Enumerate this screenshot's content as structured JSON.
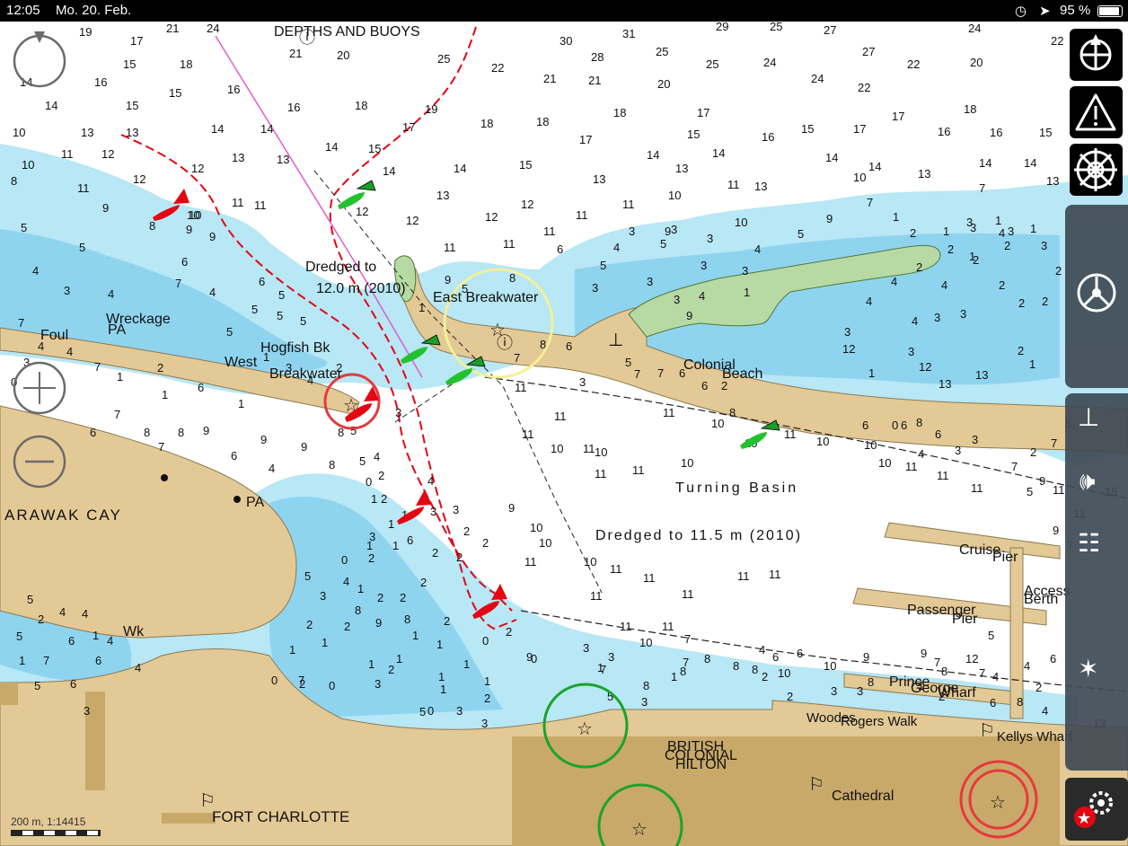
{
  "status": {
    "time": "12:05",
    "date": "Mo. 20. Feb.",
    "battery": "95 %"
  },
  "labels": {
    "depths_buoys": "DEPTHS AND BUOYS",
    "dredged_12": "Dredged to",
    "dredged_12b": "12.0 m (2010)",
    "east_breakwater": "East Breakwater",
    "wreckage": "Wreckage",
    "pa1": "PA",
    "foul": "Foul",
    "hogfish": "Hogfish Bk",
    "west": "West",
    "breakwater": "Breakwater",
    "colonial": "Colonial",
    "beach": "Beach",
    "turning_basin": "Turning Basin",
    "dredged_115": "Dredged to 11.5 m (2010)",
    "arawak": "ARAWAK CAY",
    "pa2": "PA",
    "wk": "Wk",
    "cruise": "Cruise",
    "pier1": "Pier",
    "access": "Access",
    "berth": "Berth",
    "passenger": "Passenger",
    "pier2": "Pier",
    "prince": "Prince",
    "george": "George",
    "wharf": "Wharf",
    "woodes": "Woodes",
    "rogers": "Rogers Walk",
    "kellys": "Kellys Wharf",
    "british": "BRITISH",
    "colonial2": "COLONIAL",
    "hilton": "HILTON",
    "cathedral": "Cathedral",
    "fort": "FORT CHARLOTTE"
  },
  "scale": {
    "text": "200 m, 1:14415"
  },
  "soundings": [
    [
      "19",
      88,
      40
    ],
    [
      "21",
      185,
      36
    ],
    [
      "24",
      230,
      36
    ],
    [
      "21",
      322,
      64
    ],
    [
      "20",
      375,
      66
    ],
    [
      "25",
      487,
      70
    ],
    [
      "22",
      547,
      80
    ],
    [
      "30",
      623,
      50
    ],
    [
      "31",
      693,
      42
    ],
    [
      "28",
      658,
      68
    ],
    [
      "25",
      730,
      62
    ],
    [
      "21",
      605,
      92
    ],
    [
      "21",
      655,
      94
    ],
    [
      "25",
      786,
      76
    ],
    [
      "29",
      797,
      34
    ],
    [
      "25",
      857,
      34
    ],
    [
      "27",
      917,
      38
    ],
    [
      "24",
      850,
      74
    ],
    [
      "27",
      960,
      62
    ],
    [
      "22",
      1010,
      76
    ],
    [
      "24",
      903,
      92
    ],
    [
      "22",
      955,
      102
    ],
    [
      "24",
      1078,
      36
    ],
    [
      "22",
      1170,
      50
    ],
    [
      "20",
      1080,
      74
    ],
    [
      "17",
      145,
      50
    ],
    [
      "15",
      137,
      76
    ],
    [
      "18",
      200,
      76
    ],
    [
      "16",
      105,
      96
    ],
    [
      "15",
      188,
      108
    ],
    [
      "15",
      140,
      122
    ],
    [
      "16",
      253,
      104
    ],
    [
      "16",
      320,
      124
    ],
    [
      "18",
      395,
      122
    ],
    [
      "19",
      473,
      126
    ],
    [
      "18",
      535,
      142
    ],
    [
      "18",
      597,
      140
    ],
    [
      "18",
      683,
      130
    ],
    [
      "20",
      732,
      98
    ],
    [
      "17",
      776,
      130
    ],
    [
      "15",
      765,
      154
    ],
    [
      "16",
      848,
      157
    ],
    [
      "15",
      892,
      148
    ],
    [
      "17",
      950,
      148
    ],
    [
      "17",
      993,
      134
    ],
    [
      "16",
      1044,
      151
    ],
    [
      "18",
      1073,
      126
    ],
    [
      "16",
      1102,
      152
    ],
    [
      "15",
      1157,
      152
    ],
    [
      "14",
      22,
      96
    ],
    [
      "14",
      50,
      122
    ],
    [
      "13",
      90,
      152
    ],
    [
      "13",
      140,
      152
    ],
    [
      "14",
      235,
      148
    ],
    [
      "14",
      290,
      148
    ],
    [
      "13",
      258,
      180
    ],
    [
      "13",
      308,
      182
    ],
    [
      "14",
      362,
      168
    ],
    [
      "15",
      410,
      170
    ],
    [
      "17",
      448,
      146
    ],
    [
      "17",
      645,
      160
    ],
    [
      "14",
      720,
      177
    ],
    [
      "14",
      793,
      175
    ],
    [
      "15",
      578,
      188
    ],
    [
      "14",
      505,
      192
    ],
    [
      "13",
      660,
      204
    ],
    [
      "13",
      752,
      192
    ],
    [
      "13",
      840,
      212
    ],
    [
      "14",
      919,
      180
    ],
    [
      "14",
      967,
      190
    ],
    [
      "13",
      1022,
      198
    ],
    [
      "14",
      1090,
      186
    ],
    [
      "14",
      1140,
      186
    ],
    [
      "13",
      1165,
      206
    ],
    [
      "7",
      1090,
      214
    ],
    [
      "10",
      14,
      152
    ],
    [
      "10",
      24,
      188
    ],
    [
      "8",
      12,
      206
    ],
    [
      "11",
      68,
      176
    ],
    [
      "12",
      113,
      176
    ],
    [
      "12",
      148,
      204
    ],
    [
      "12",
      213,
      192
    ],
    [
      "11",
      86,
      214
    ],
    [
      "9",
      114,
      236
    ],
    [
      "10",
      208,
      244
    ],
    [
      "9",
      207,
      260
    ],
    [
      "9",
      233,
      268
    ],
    [
      "14",
      426,
      195
    ],
    [
      "12",
      396,
      240
    ],
    [
      "13",
      486,
      222
    ],
    [
      "12",
      452,
      250
    ],
    [
      "12",
      540,
      246
    ],
    [
      "12",
      580,
      232
    ],
    [
      "11",
      605,
      262
    ],
    [
      "11",
      641,
      244
    ],
    [
      "11",
      693,
      232
    ],
    [
      "10",
      744,
      222
    ],
    [
      "11",
      810,
      210
    ],
    [
      "10",
      950,
      202
    ],
    [
      "9",
      740,
      262
    ],
    [
      "10",
      818,
      252
    ],
    [
      "5",
      23,
      258
    ],
    [
      "5",
      88,
      280
    ],
    [
      "4",
      36,
      306
    ],
    [
      "4",
      120,
      332
    ],
    [
      "3",
      71,
      328
    ],
    [
      "6",
      202,
      296
    ],
    [
      "7",
      195,
      320
    ],
    [
      "4",
      233,
      330
    ],
    [
      "5",
      280,
      349
    ],
    [
      "5",
      252,
      374
    ],
    [
      "6",
      288,
      318
    ],
    [
      "5",
      310,
      333
    ],
    [
      "5",
      308,
      356
    ],
    [
      "5",
      334,
      362
    ],
    [
      "11",
      258,
      230
    ],
    [
      "11",
      283,
      233
    ],
    [
      "8",
      166,
      256
    ],
    [
      "10",
      210,
      244
    ],
    [
      "9",
      495,
      316
    ],
    [
      "11",
      494,
      280
    ],
    [
      "11",
      560,
      276
    ],
    [
      "6",
      620,
      282
    ],
    [
      "4",
      683,
      280
    ],
    [
      "5",
      668,
      300
    ],
    [
      "5",
      735,
      276
    ],
    [
      "3",
      700,
      262
    ],
    [
      "3",
      747,
      260
    ],
    [
      "3",
      787,
      270
    ],
    [
      "9",
      920,
      248
    ],
    [
      "7",
      965,
      230
    ],
    [
      "5",
      888,
      265
    ],
    [
      "4",
      840,
      282
    ],
    [
      "3",
      780,
      300
    ],
    [
      "3",
      826,
      306
    ],
    [
      "2",
      1055,
      282
    ],
    [
      "3",
      1080,
      258
    ],
    [
      "2",
      1020,
      302
    ],
    [
      "1",
      1079,
      290
    ],
    [
      "2",
      1118,
      278
    ],
    [
      "2",
      1134,
      342
    ],
    [
      "2",
      1112,
      322
    ],
    [
      "4",
      992,
      318
    ],
    [
      "4",
      1048,
      322
    ],
    [
      "2",
      1175,
      306
    ],
    [
      "1",
      994,
      246
    ],
    [
      "2",
      1013,
      264
    ],
    [
      "1",
      1050,
      262
    ],
    [
      "1",
      1108,
      250
    ],
    [
      "2",
      1083,
      294
    ],
    [
      "3",
      1076,
      252
    ],
    [
      "4",
      1112,
      264
    ],
    [
      "3",
      1122,
      262
    ],
    [
      "1",
      1147,
      259
    ],
    [
      "3",
      1159,
      278
    ],
    [
      "2",
      1160,
      340
    ],
    [
      "7",
      20,
      364
    ],
    [
      "4",
      42,
      390
    ],
    [
      "4",
      74,
      396
    ],
    [
      "3",
      26,
      408
    ],
    [
      "0",
      12,
      430
    ],
    [
      "7",
      105,
      413
    ],
    [
      "1",
      130,
      424
    ],
    [
      "2",
      175,
      414
    ],
    [
      "1",
      180,
      444
    ],
    [
      "6",
      220,
      436
    ],
    [
      "1",
      265,
      454
    ],
    [
      "1",
      293,
      402
    ],
    [
      "3",
      318,
      414
    ],
    [
      "4",
      342,
      428
    ],
    [
      "2",
      374,
      414
    ],
    [
      "5",
      390,
      484
    ],
    [
      "3",
      440,
      464
    ],
    [
      "4",
      416,
      513
    ],
    [
      "1",
      466,
      347
    ],
    [
      "5",
      514,
      326
    ],
    [
      "8",
      567,
      314
    ],
    [
      "3",
      659,
      325
    ],
    [
      "3",
      720,
      318
    ],
    [
      "3",
      750,
      338
    ],
    [
      "4",
      778,
      334
    ],
    [
      "1",
      828,
      330
    ],
    [
      "9",
      764,
      356
    ],
    [
      "4",
      964,
      340
    ],
    [
      "4",
      1015,
      362
    ],
    [
      "3",
      1040,
      358
    ],
    [
      "3",
      1069,
      354
    ],
    [
      "3",
      940,
      374
    ],
    [
      "3",
      1011,
      396
    ],
    [
      "2",
      1133,
      395
    ],
    [
      "1",
      1146,
      410
    ],
    [
      "12",
      938,
      393
    ],
    [
      "12",
      1023,
      413
    ],
    [
      "13",
      1086,
      422
    ],
    [
      "13",
      1045,
      432
    ],
    [
      "1",
      967,
      420
    ],
    [
      "6",
      630,
      390
    ],
    [
      "8",
      601,
      388
    ],
    [
      "7",
      572,
      403
    ],
    [
      "3",
      645,
      430
    ],
    [
      "5",
      696,
      408
    ],
    [
      "7",
      706,
      421
    ],
    [
      "7",
      732,
      420
    ],
    [
      "6",
      756,
      420
    ],
    [
      "6",
      781,
      434
    ],
    [
      "2",
      803,
      434
    ],
    [
      "8",
      812,
      464
    ],
    [
      "11",
      573,
      436
    ],
    [
      "11",
      617,
      468
    ],
    [
      "11",
      738,
      464
    ],
    [
      "10",
      613,
      504
    ],
    [
      "11",
      581,
      488
    ],
    [
      "11",
      649,
      504
    ],
    [
      "10",
      662,
      508
    ],
    [
      "11",
      662,
      532
    ],
    [
      "11",
      704,
      528
    ],
    [
      "10",
      758,
      520
    ],
    [
      "10",
      792,
      476
    ],
    [
      "10",
      829,
      498
    ],
    [
      "11",
      873,
      488
    ],
    [
      "10",
      909,
      496
    ],
    [
      "10",
      962,
      500
    ],
    [
      "10",
      978,
      520
    ],
    [
      "11",
      1008,
      524
    ],
    [
      "11",
      1043,
      534
    ],
    [
      "11",
      1081,
      548
    ],
    [
      "11",
      1172,
      550
    ],
    [
      "7",
      1126,
      524
    ],
    [
      "9",
      1157,
      540
    ],
    [
      "5",
      1143,
      552
    ],
    [
      "4",
      1022,
      510
    ],
    [
      "3",
      1063,
      506
    ],
    [
      "6",
      1041,
      488
    ],
    [
      "8",
      1020,
      475
    ],
    [
      "6",
      1003,
      478
    ],
    [
      "3",
      1082,
      494
    ],
    [
      "0",
      993,
      478
    ],
    [
      "6",
      960,
      478
    ],
    [
      "2",
      1147,
      508
    ],
    [
      "5",
      1186,
      476
    ],
    [
      "7",
      1170,
      498
    ],
    [
      "11",
      1195,
      576
    ],
    [
      "9",
      1172,
      595
    ],
    [
      "15",
      1230,
      552
    ],
    [
      "7",
      1188,
      612
    ],
    [
      "8",
      198,
      486
    ],
    [
      "6",
      100,
      486
    ],
    [
      "7",
      127,
      466
    ],
    [
      "9",
      226,
      484
    ],
    [
      "8",
      160,
      486
    ],
    [
      "7",
      176,
      502
    ],
    [
      "6",
      257,
      512
    ],
    [
      "4",
      299,
      526
    ],
    [
      "9",
      290,
      494
    ],
    [
      "9",
      335,
      502
    ],
    [
      "8",
      376,
      486
    ],
    [
      "8",
      366,
      522
    ],
    [
      "5",
      400,
      518
    ],
    [
      "2",
      421,
      534
    ],
    [
      "2",
      424,
      560
    ],
    [
      "1",
      413,
      560
    ],
    [
      "1",
      447,
      578
    ],
    [
      "4",
      476,
      540
    ],
    [
      "3",
      479,
      574
    ],
    [
      "3",
      504,
      572
    ],
    [
      "2",
      516,
      596
    ],
    [
      "2",
      537,
      609
    ],
    [
      "2",
      508,
      625
    ],
    [
      "2",
      481,
      620
    ],
    [
      "2",
      468,
      653
    ],
    [
      "1",
      432,
      588
    ],
    [
      "1",
      437,
      612
    ],
    [
      "1",
      408,
      612
    ],
    [
      "9",
      566,
      570
    ],
    [
      "10",
      590,
      592
    ],
    [
      "10",
      600,
      609
    ],
    [
      "11",
      584,
      630
    ],
    [
      "10",
      650,
      630
    ],
    [
      "11",
      679,
      638
    ],
    [
      "11",
      716,
      648
    ],
    [
      "11",
      759,
      666
    ],
    [
      "11",
      821,
      646
    ],
    [
      "11",
      856,
      644
    ],
    [
      "11",
      657,
      668
    ],
    [
      "11",
      737,
      702
    ],
    [
      "11",
      690,
      702
    ],
    [
      "10",
      712,
      720
    ],
    [
      "7",
      762,
      716
    ],
    [
      "7",
      760,
      742
    ],
    [
      "8",
      784,
      738
    ],
    [
      "8",
      816,
      746
    ],
    [
      "8",
      837,
      750
    ],
    [
      "6",
      860,
      736
    ],
    [
      "4",
      845,
      728
    ],
    [
      "2",
      848,
      758
    ],
    [
      "2",
      876,
      780
    ],
    [
      "6",
      887,
      732
    ],
    [
      "10",
      866,
      754
    ],
    [
      "10",
      917,
      746
    ],
    [
      "9",
      961,
      736
    ],
    [
      "9",
      1025,
      732
    ],
    [
      "8",
      1048,
      752
    ],
    [
      "7",
      1090,
      754
    ],
    [
      "4",
      1105,
      758
    ],
    [
      "4",
      1140,
      746
    ],
    [
      "2",
      1153,
      770
    ],
    [
      "8",
      966,
      764
    ],
    [
      "1",
      1022,
      768
    ],
    [
      "2",
      1045,
      780
    ],
    [
      "3",
      925,
      774
    ],
    [
      "3",
      954,
      774
    ],
    [
      "5",
      1100,
      712
    ],
    [
      "7",
      1040,
      742
    ],
    [
      "6",
      1169,
      738
    ],
    [
      "8",
      1132,
      786
    ],
    [
      "4",
      1160,
      796
    ],
    [
      "12",
      1075,
      738
    ],
    [
      "6",
      1102,
      787
    ],
    [
      "13",
      1217,
      810
    ],
    [
      "0",
      407,
      541
    ],
    [
      "3",
      411,
      602
    ],
    [
      "2",
      410,
      626
    ],
    [
      "1",
      398,
      660
    ],
    [
      "8",
      395,
      684
    ],
    [
      "9",
      418,
      698
    ],
    [
      "5",
      339,
      646
    ],
    [
      "3",
      356,
      668
    ],
    [
      "2",
      341,
      700
    ],
    [
      "2",
      383,
      702
    ],
    [
      "1",
      358,
      720
    ],
    [
      "1",
      410,
      744
    ],
    [
      "2",
      432,
      750
    ],
    [
      "3",
      417,
      766
    ],
    [
      "1",
      490,
      772
    ],
    [
      "0",
      476,
      796
    ],
    [
      "3",
      508,
      796
    ],
    [
      "3",
      536,
      810
    ],
    [
      "2",
      539,
      782
    ],
    [
      "2",
      563,
      708
    ],
    [
      "0",
      591,
      738
    ],
    [
      "2",
      494,
      696
    ],
    [
      "1",
      459,
      712
    ],
    [
      "1",
      486,
      722
    ],
    [
      "1",
      516,
      744
    ],
    [
      "1",
      539,
      763
    ],
    [
      "0",
      537,
      718
    ],
    [
      "9",
      586,
      736
    ],
    [
      "3",
      649,
      726
    ],
    [
      "3",
      677,
      736
    ],
    [
      "1",
      665,
      748
    ],
    [
      "7",
      668,
      750
    ],
    [
      "5",
      676,
      780
    ],
    [
      "3",
      714,
      786
    ],
    [
      "1",
      747,
      758
    ],
    [
      "8",
      716,
      768
    ],
    [
      "8",
      757,
      752
    ],
    [
      "0",
      380,
      628
    ],
    [
      "4",
      382,
      652
    ],
    [
      "2",
      420,
      670
    ],
    [
      "8",
      450,
      694
    ],
    [
      "6",
      453,
      606
    ],
    [
      "2",
      445,
      670
    ],
    [
      "1",
      322,
      728
    ],
    [
      "2",
      333,
      766
    ],
    [
      "0",
      366,
      768
    ],
    [
      "0",
      302,
      762
    ],
    [
      "7",
      332,
      762
    ],
    [
      "5",
      467,
      797
    ],
    [
      "1",
      488,
      758
    ],
    [
      "1",
      441,
      738
    ],
    [
      "5",
      30,
      672
    ],
    [
      "4",
      66,
      686
    ],
    [
      "4",
      91,
      688
    ],
    [
      "2",
      42,
      694
    ],
    [
      "6",
      76,
      718
    ],
    [
      "1",
      103,
      712
    ],
    [
      "4",
      119,
      718
    ],
    [
      "5",
      18,
      713
    ],
    [
      "6",
      106,
      740
    ],
    [
      "5",
      38,
      768
    ],
    [
      "1",
      21,
      740
    ],
    [
      "7",
      48,
      740
    ],
    [
      "6",
      78,
      766
    ],
    [
      "3",
      93,
      796
    ],
    [
      "4",
      150,
      748
    ]
  ],
  "colors": {
    "deep": "#ffffff",
    "shallow": "#b8e7f5",
    "veryShallow": "#8fd4ef",
    "land": "#e3c995",
    "landDark": "#c9a96a",
    "drying": "#b7d9a3",
    "redMark": "#e30613",
    "greenMark": "#1a9e2a"
  },
  "icons": [
    "compass-icon",
    "warning-icon",
    "wheel-icon",
    "helm-icon",
    "anchor-icon",
    "sound-icon",
    "settings-icon",
    "zoom-out-icon",
    "recenter-icon"
  ]
}
